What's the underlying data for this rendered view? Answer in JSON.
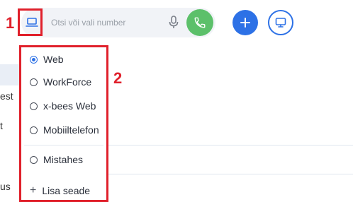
{
  "search": {
    "placeholder": "Otsi või vali number"
  },
  "icons": {
    "device": "laptop-icon",
    "mic": "microphone-icon",
    "call": "phone-icon",
    "add": "plus-icon",
    "screen": "monitor-icon"
  },
  "colors": {
    "accent_blue": "#2d71e6",
    "call_green": "#5cc06a",
    "annotation_red": "#e0202b"
  },
  "annotations": {
    "one": "1",
    "two": "2"
  },
  "dropdown": {
    "options": [
      {
        "label": "Web",
        "selected": true
      },
      {
        "label": "WorkForce",
        "selected": false
      },
      {
        "label": "x-bees Web",
        "selected": false
      },
      {
        "label": "Mobiiltelefon",
        "selected": false
      },
      {
        "label": "Mistahes",
        "selected": false
      }
    ],
    "add_device": "Lisa seade"
  },
  "background_text": [
    "est",
    "t",
    "us"
  ]
}
